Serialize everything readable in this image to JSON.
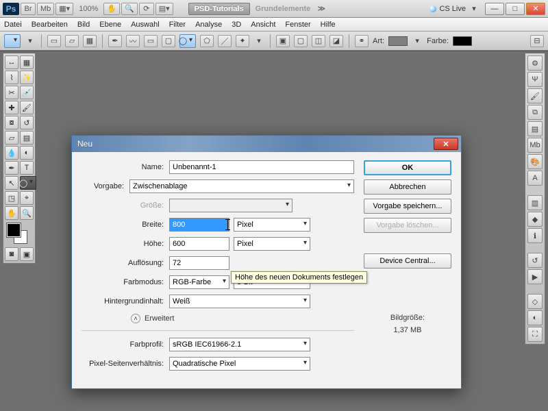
{
  "appbar": {
    "zoom": "100%",
    "tabs": [
      "PSD-Tutorials",
      "Grundelemente"
    ],
    "cslive": "CS Live"
  },
  "menubar": [
    "Datei",
    "Bearbeiten",
    "Bild",
    "Ebene",
    "Auswahl",
    "Filter",
    "Analyse",
    "3D",
    "Ansicht",
    "Fenster",
    "Hilfe"
  ],
  "optbar": {
    "art": "Art:",
    "farbe": "Farbe:"
  },
  "dialog": {
    "title": "Neu",
    "name_label": "Name:",
    "name_value": "Unbenannt-1",
    "vorgabe_label": "Vorgabe:",
    "vorgabe_value": "Zwischenablage",
    "groesse_label": "Größe:",
    "breite_label": "Breite:",
    "breite_value": "800",
    "breite_unit": "Pixel",
    "hoehe_label": "Höhe:",
    "hoehe_value": "600",
    "hoehe_unit": "Pixel",
    "aufl_label": "Auflösung:",
    "aufl_value": "72",
    "farbmodus_label": "Farbmodus:",
    "farbmodus_value": "RGB-Farbe",
    "farbmodus_depth": "8-Bit",
    "hginhalt_label": "Hintergrundinhalt:",
    "hginhalt_value": "Weiß",
    "erweitert": "Erweitert",
    "farbprofil_label": "Farbprofil:",
    "farbprofil_value": "sRGB IEC61966-2.1",
    "pixelsv_label": "Pixel-Seitenverhältnis:",
    "pixelsv_value": "Quadratische Pixel",
    "ok": "OK",
    "cancel": "Abbrechen",
    "save_preset": "Vorgabe speichern...",
    "delete_preset": "Vorgabe löschen...",
    "device_central": "Device Central...",
    "bildgroesse_label": "Bildgröße:",
    "bildgroesse_value": "1,37 MB",
    "tooltip": "Höhe des neuen Dokuments festlegen"
  }
}
